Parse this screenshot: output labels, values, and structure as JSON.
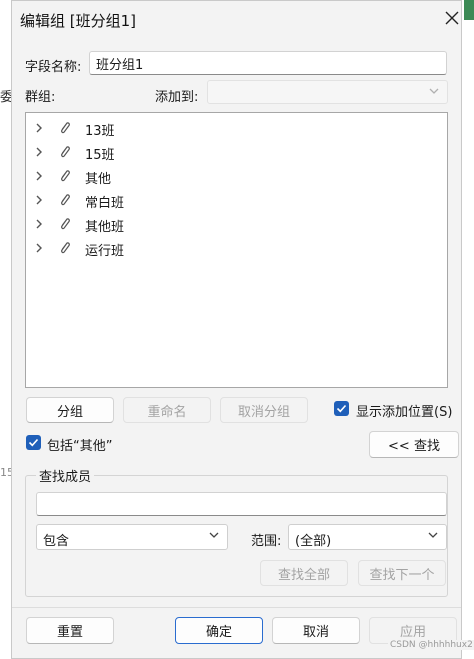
{
  "dialog": {
    "title": "编辑组 [班分组1]",
    "field_name_label": "字段名称:",
    "field_name_value": "班分组1",
    "group_label": "群组:",
    "add_to_label": "添加到:",
    "add_to_value": ""
  },
  "tree": {
    "items": [
      {
        "label": "13班"
      },
      {
        "label": "15班"
      },
      {
        "label": "其他"
      },
      {
        "label": "常白班"
      },
      {
        "label": "其他班"
      },
      {
        "label": "运行班"
      }
    ]
  },
  "actions": {
    "group_button": "分组",
    "rename_button": "重命名",
    "ungroup_button": "取消分组",
    "show_add_location_label": "显示添加位置(S)",
    "include_other_label": "包括“其他”",
    "find_button": "<< 查找"
  },
  "find_members": {
    "title": "查找成员",
    "search_value": "",
    "match_mode": "包含",
    "range_label": "范围:",
    "range_value": "(全部)",
    "find_all_button": "查找全部",
    "find_next_button": "查找下一个"
  },
  "footer": {
    "reset_button": "重置",
    "ok_button": "确定",
    "cancel_button": "取消",
    "apply_button": "应用"
  },
  "background": {
    "left_glyph_1": "委",
    "left_glyph_2": "15"
  },
  "watermark": "CSDN @hhhhhux2",
  "colors": {
    "accent": "#1f5fb9",
    "disabled_text": "#a3a3a3"
  }
}
